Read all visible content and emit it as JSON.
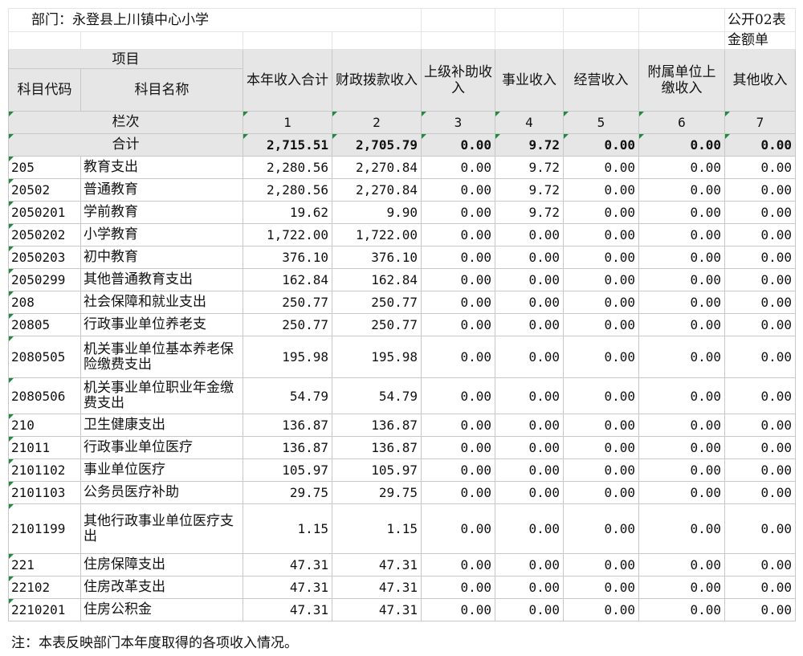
{
  "header": {
    "department": "部门：永登县上川镇中心小学",
    "form_code": "公开02表",
    "unit": "金额单"
  },
  "columns": {
    "project": "项目",
    "code": "科目代码",
    "name": "科目名称",
    "c1": "本年收入合计",
    "c2": "财政拨款收入",
    "c3": "上级补助收入",
    "c4": "事业收入",
    "c5": "经营收入",
    "c6": "附属单位上缴收入",
    "c7": "其他收入"
  },
  "lanci": {
    "label": "栏次",
    "nums": [
      "1",
      "2",
      "3",
      "4",
      "5",
      "6",
      "7"
    ]
  },
  "total": {
    "label": "合计",
    "values": [
      "2,715.51",
      "2,705.79",
      "0.00",
      "9.72",
      "0.00",
      "0.00",
      "0.00"
    ]
  },
  "rows": [
    {
      "code": "205",
      "name": "教育支出",
      "values": [
        "2,280.56",
        "2,270.84",
        "0.00",
        "9.72",
        "0.00",
        "0.00",
        "0.00"
      ]
    },
    {
      "code": "20502",
      "name": "普通教育",
      "values": [
        "2,280.56",
        "2,270.84",
        "0.00",
        "9.72",
        "0.00",
        "0.00",
        "0.00"
      ]
    },
    {
      "code": "2050201",
      "name": "学前教育",
      "values": [
        "19.62",
        "9.90",
        "0.00",
        "9.72",
        "0.00",
        "0.00",
        "0.00"
      ]
    },
    {
      "code": "2050202",
      "name": "小学教育",
      "values": [
        "1,722.00",
        "1,722.00",
        "0.00",
        "0.00",
        "0.00",
        "0.00",
        "0.00"
      ]
    },
    {
      "code": "2050203",
      "name": "初中教育",
      "values": [
        "376.10",
        "376.10",
        "0.00",
        "0.00",
        "0.00",
        "0.00",
        "0.00"
      ]
    },
    {
      "code": "2050299",
      "name": "其他普通教育支出",
      "values": [
        "162.84",
        "162.84",
        "0.00",
        "0.00",
        "0.00",
        "0.00",
        "0.00"
      ]
    },
    {
      "code": "208",
      "name": "社会保障和就业支出",
      "values": [
        "250.77",
        "250.77",
        "0.00",
        "0.00",
        "0.00",
        "0.00",
        "0.00"
      ]
    },
    {
      "code": "20805",
      "name": "行政事业单位养老支",
      "values": [
        "250.77",
        "250.77",
        "0.00",
        "0.00",
        "0.00",
        "0.00",
        "0.00"
      ]
    },
    {
      "code": "2080505",
      "name": "机关事业单位基本养老保险缴费支出",
      "values": [
        "195.98",
        "195.98",
        "0.00",
        "0.00",
        "0.00",
        "0.00",
        "0.00"
      ]
    },
    {
      "code": "2080506",
      "name": "机关事业单位职业年金缴费支出",
      "values": [
        "54.79",
        "54.79",
        "0.00",
        "0.00",
        "0.00",
        "0.00",
        "0.00"
      ]
    },
    {
      "code": "210",
      "name": "卫生健康支出",
      "values": [
        "136.87",
        "136.87",
        "0.00",
        "0.00",
        "0.00",
        "0.00",
        "0.00"
      ]
    },
    {
      "code": "21011",
      "name": "行政事业单位医疗",
      "values": [
        "136.87",
        "136.87",
        "0.00",
        "0.00",
        "0.00",
        "0.00",
        "0.00"
      ]
    },
    {
      "code": "2101102",
      "name": "事业单位医疗",
      "values": [
        "105.97",
        "105.97",
        "0.00",
        "0.00",
        "0.00",
        "0.00",
        "0.00"
      ]
    },
    {
      "code": "2101103",
      "name": "公务员医疗补助",
      "values": [
        "29.75",
        "29.75",
        "0.00",
        "0.00",
        "0.00",
        "0.00",
        "0.00"
      ]
    },
    {
      "code": "2101199",
      "name": "其他行政事业单位医疗支出",
      "values": [
        "1.15",
        "1.15",
        "0.00",
        "0.00",
        "0.00",
        "0.00",
        "0.00"
      ]
    },
    {
      "code": "221",
      "name": "住房保障支出",
      "values": [
        "47.31",
        "47.31",
        "0.00",
        "0.00",
        "0.00",
        "0.00",
        "0.00"
      ]
    },
    {
      "code": "22102",
      "name": "住房改革支出",
      "values": [
        "47.31",
        "47.31",
        "0.00",
        "0.00",
        "0.00",
        "0.00",
        "0.00"
      ]
    },
    {
      "code": "2210201",
      "name": "住房公积金",
      "values": [
        "47.31",
        "47.31",
        "0.00",
        "0.00",
        "0.00",
        "0.00",
        "0.00"
      ]
    }
  ],
  "note": "注：本表反映部门本年度取得的各项收入情况。"
}
